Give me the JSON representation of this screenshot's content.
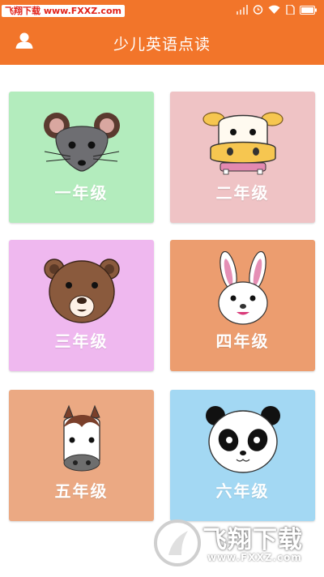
{
  "status": {
    "watermark_badge": "飞翔下载 www.FXXZ.com",
    "icons": [
      "signal-icon",
      "alarm-icon",
      "wifi-icon",
      "sim-icon",
      "battery-icon"
    ]
  },
  "appbar": {
    "title": "少儿英语点读",
    "user_icon": "user-icon"
  },
  "grades": [
    {
      "label": "一年级",
      "animal": "mouse",
      "bg": "#b3ecbd"
    },
    {
      "label": "二年级",
      "animal": "cow",
      "bg": "#efc3c5"
    },
    {
      "label": "三年级",
      "animal": "bear",
      "bg": "#efb8ef"
    },
    {
      "label": "四年级",
      "animal": "rabbit",
      "bg": "#ec9d6f"
    },
    {
      "label": "五年级",
      "animal": "horse",
      "bg": "#eba983"
    },
    {
      "label": "六年级",
      "animal": "panda",
      "bg": "#a3d8f3"
    }
  ],
  "watermark": {
    "title": "飞翔下载",
    "url": "www.FXXZ.com"
  },
  "colors": {
    "primary": "#f2752a"
  }
}
